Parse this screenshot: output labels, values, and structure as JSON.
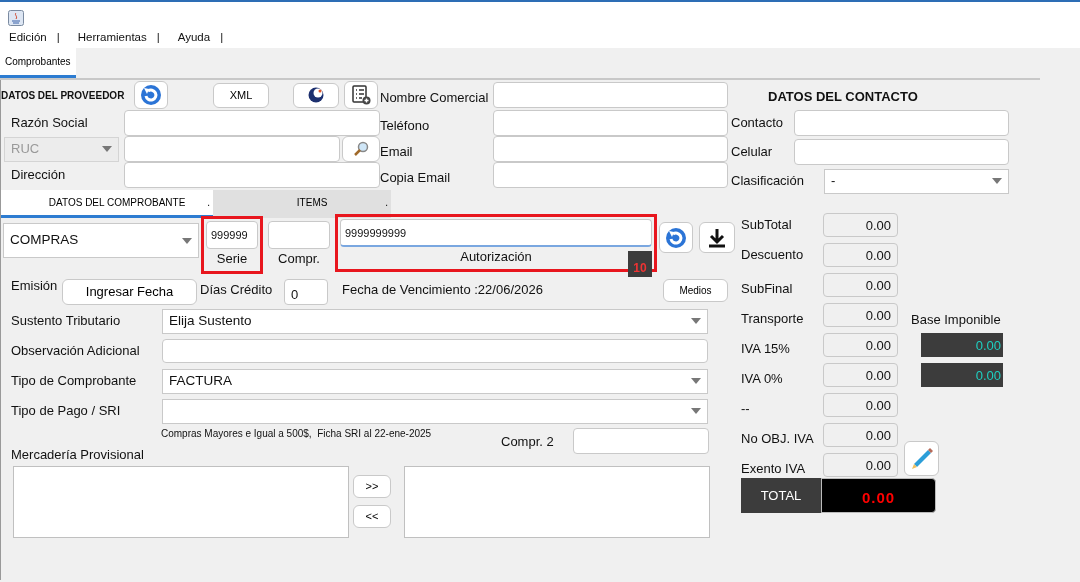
{
  "menu": [
    {
      "label": "Edición",
      "separator": "|"
    },
    {
      "label": "Herramientas",
      "separator": "|"
    },
    {
      "label": "Ayuda",
      "separator": "|"
    }
  ],
  "main_tabs": [
    {
      "label": "Comprobantes",
      "selected": true
    }
  ],
  "proveedor": {
    "title": "DATOS DEL PROVEEDOR",
    "xml_button": "XML",
    "razon_social": {
      "label": "Razón Social"
    },
    "id_type": {
      "value": "RUC",
      "disabled": true
    },
    "direccion": {
      "label": "Dirección"
    }
  },
  "comercial": {
    "fields": [
      {
        "label": "Nombre Comercial"
      },
      {
        "label": "Teléfono"
      },
      {
        "label": "Email"
      },
      {
        "label": "Copia Email"
      }
    ]
  },
  "contacto": {
    "title": "DATOS DEL CONTACTO",
    "fields": [
      {
        "label": "Contacto",
        "kind": "input"
      },
      {
        "label": "Celular",
        "kind": "input"
      },
      {
        "label": "Clasificación",
        "kind": "select",
        "value": "-"
      }
    ]
  },
  "section_tabs": [
    {
      "label": "DATOS DEL COMPROBANTE",
      "marker": ".",
      "selected": true
    },
    {
      "label": "ITEMS",
      "marker": ".",
      "selected": false
    }
  ],
  "comprobante": {
    "tipo": "COMPRAS",
    "serie": {
      "value": "999999",
      "label": "Serie",
      "highlighted": true
    },
    "compr": {
      "label": "Compr."
    },
    "autorizacion": {
      "value": "9999999999",
      "label": "Autorización",
      "highlighted": true,
      "focused": true
    },
    "counter": "10",
    "emision_label": "Emisión",
    "fecha_button": "Ingresar Fecha",
    "dias_label": "Días Crédito",
    "dias_value": "0",
    "vencimiento": "Fecha de Vencimiento :22/06/2026",
    "medios_button": "Medios",
    "rows": [
      {
        "label": "Sustento Tributario",
        "kind": "select",
        "value": "Elija Sustento"
      },
      {
        "label": "Observación Adicional",
        "kind": "input"
      },
      {
        "label": "Tipo de Comprobante",
        "kind": "select",
        "value": "FACTURA"
      },
      {
        "label": "Tipo de Pago / SRI",
        "kind": "select"
      }
    ],
    "note": "Compras Mayores e Igual a 500$,  Ficha SRI al 22-ene-2025",
    "compr2_label": "Compr. 2",
    "mercaderia_label": "Mercadería Provisional",
    "move_buttons": [
      ">>",
      "<<"
    ]
  },
  "totales": {
    "rows": [
      {
        "label": "SubTotal",
        "value": "0.00"
      },
      {
        "label": "Descuento",
        "value": "0.00"
      },
      {
        "label": "SubFinal",
        "value": "0.00"
      },
      {
        "label": "Transporte",
        "value": "0.00"
      },
      {
        "label": "IVA 15%",
        "value": "0.00"
      },
      {
        "label": "IVA 0%",
        "value": "0.00"
      },
      {
        "label": "--",
        "value": "0.00"
      },
      {
        "label": "No OBJ. IVA",
        "value": "0.00"
      },
      {
        "label": "Exento IVA",
        "value": "0.00"
      }
    ],
    "base_imponible": {
      "label": "Base Imponible",
      "values": [
        "0.00",
        "0.00"
      ]
    },
    "total": {
      "label": "TOTAL",
      "value": "0.00"
    }
  }
}
